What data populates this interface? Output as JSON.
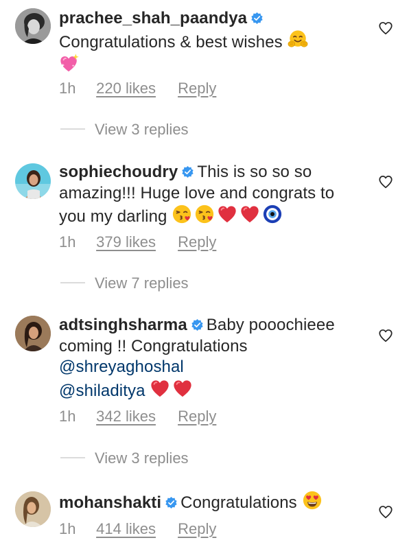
{
  "comments": [
    {
      "username": "prachee_shah_paandya",
      "text": "Congratulations & best wishes",
      "emojis": [
        "hugging-face",
        "sparkling-heart"
      ],
      "time": "1h",
      "likes": "220 likes",
      "reply_label": "Reply",
      "view_replies": "View 3 replies"
    },
    {
      "username": "sophiechoudry",
      "text": "This is so so so amazing!!! Huge love and congrats to you my darling",
      "emojis": [
        "kissing-heart",
        "kissing-heart",
        "red-heart",
        "red-heart",
        "nazar-amulet"
      ],
      "time": "1h",
      "likes": "379 likes",
      "reply_label": "Reply",
      "view_replies": "View 7 replies"
    },
    {
      "username": "adtsinghsharma",
      "text": "Baby pooochieee coming !! Congratulations",
      "mentions": [
        "@shreyaghoshal",
        "@shiladitya"
      ],
      "emojis": [
        "red-heart",
        "red-heart"
      ],
      "time": "1h",
      "likes": "342 likes",
      "reply_label": "Reply",
      "view_replies": "View 3 replies"
    },
    {
      "username": "mohanshakti",
      "text": "Congratulations",
      "emojis": [
        "heart-eyes"
      ],
      "time": "1h",
      "likes": "414 likes",
      "reply_label": "Reply"
    }
  ],
  "colors": {
    "text": "#262626",
    "secondary": "#8e8e8e",
    "verified": "#3897f0",
    "mention": "#00376b",
    "divider": "#dbdbdb"
  },
  "icons": {
    "verified": "verified-badge-icon",
    "like": "heart-outline-icon"
  }
}
